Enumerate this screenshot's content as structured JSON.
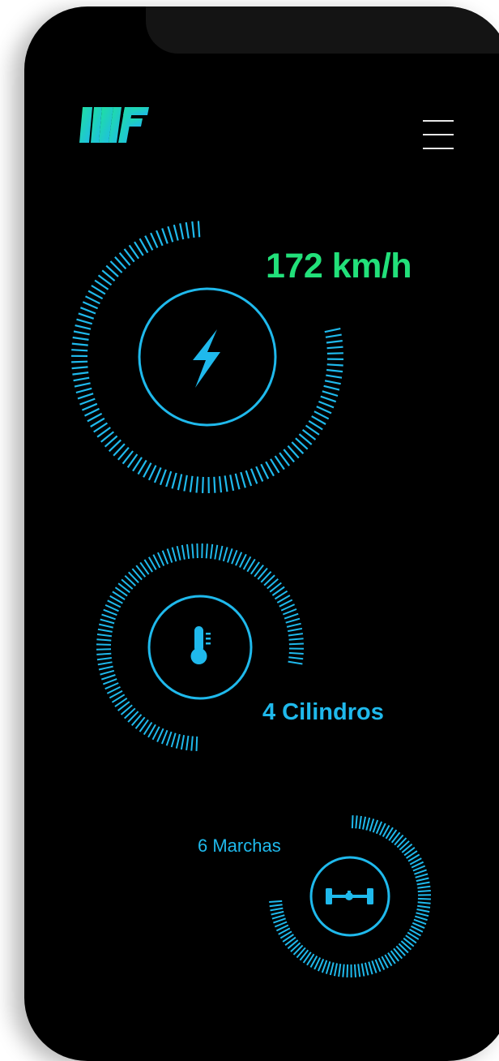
{
  "app": {
    "logo_text": "MF"
  },
  "header": {
    "menu_icon": "hamburger-menu-icon"
  },
  "stats": {
    "speed": {
      "label": "172 km/h",
      "icon": "lightning-bolt-icon",
      "color": "#22e07a"
    },
    "cylinders": {
      "label": "4 Cilindros",
      "icon": "thermometer-icon",
      "color": "#1fb9ec"
    },
    "gears": {
      "label": "6 Marchas",
      "icon": "axle-icon",
      "color": "#1fb9ec"
    }
  },
  "colors": {
    "accent": "#1fb9ec",
    "highlight": "#22e07a",
    "background": "#000000"
  }
}
